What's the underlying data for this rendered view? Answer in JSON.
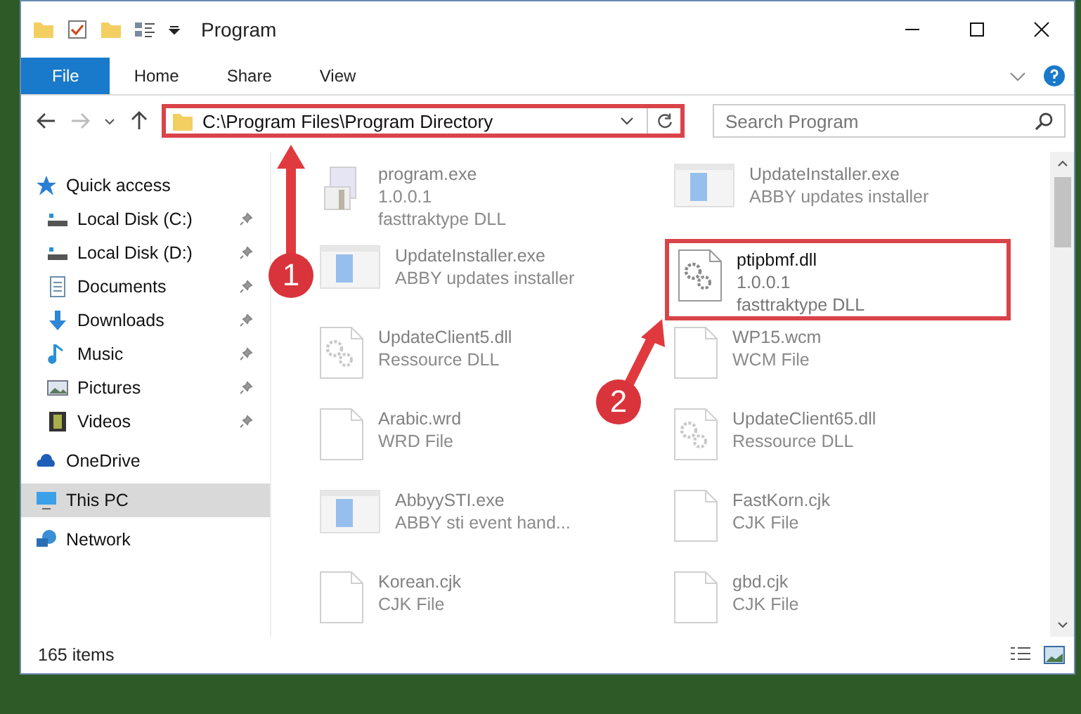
{
  "window": {
    "title": "Program"
  },
  "ribbon_tabs": [
    {
      "label": "File",
      "selected": true
    },
    {
      "label": "Home",
      "selected": false
    },
    {
      "label": "Share",
      "selected": false
    },
    {
      "label": "View",
      "selected": false
    }
  ],
  "address": {
    "path": "C:\\Program Files\\Program Directory",
    "highlighted": true
  },
  "search": {
    "placeholder": "Search Program"
  },
  "sidebar": {
    "items": [
      {
        "label": "Quick access",
        "kind": "star",
        "selected": false,
        "children": [
          {
            "label": "Local Disk (C:)",
            "kind": "drive",
            "pinned": true
          },
          {
            "label": "Local Disk (D:)",
            "kind": "drive",
            "pinned": true
          },
          {
            "label": "Documents",
            "kind": "documents",
            "pinned": true
          },
          {
            "label": "Downloads",
            "kind": "downloads",
            "pinned": true
          },
          {
            "label": "Music",
            "kind": "music",
            "pinned": true
          },
          {
            "label": "Pictures",
            "kind": "pictures",
            "pinned": true
          },
          {
            "label": "Videos",
            "kind": "videos",
            "pinned": true
          }
        ]
      },
      {
        "label": "OneDrive",
        "kind": "cloud",
        "selected": false
      },
      {
        "label": "This PC",
        "kind": "pc",
        "selected": true
      },
      {
        "label": "Network",
        "kind": "network",
        "selected": false
      }
    ]
  },
  "files": [
    {
      "name": "program.exe",
      "details": [
        "1.0.0.1",
        "fasttraktype DLL"
      ],
      "kind": "setup",
      "dimmed": true,
      "highlighted": false
    },
    {
      "name": "UpdateInstaller.exe",
      "details": [
        "ABBY updates installer"
      ],
      "kind": "app",
      "dimmed": true,
      "highlighted": false
    },
    {
      "name": "UpdateInstaller.exe",
      "details": [
        "ABBY updates installer"
      ],
      "kind": "app",
      "dimmed": true,
      "highlighted": false
    },
    {
      "name": "ptipbmf.dll",
      "details": [
        "1.0.0.1",
        "fasttraktype DLL"
      ],
      "kind": "dll",
      "dimmed": false,
      "highlighted": true
    },
    {
      "name": "UpdateClient5.dll",
      "details": [
        "Ressource DLL"
      ],
      "kind": "dll",
      "dimmed": true,
      "highlighted": false
    },
    {
      "name": "WP15.wcm",
      "details": [
        "WCM File"
      ],
      "kind": "file",
      "dimmed": true,
      "highlighted": false
    },
    {
      "name": "Arabic.wrd",
      "details": [
        "WRD File"
      ],
      "kind": "file",
      "dimmed": true,
      "highlighted": false
    },
    {
      "name": "UpdateClient65.dll",
      "details": [
        "Ressource DLL"
      ],
      "kind": "dll",
      "dimmed": true,
      "highlighted": false
    },
    {
      "name": "AbbyySTI.exe",
      "details": [
        "ABBY sti event hand..."
      ],
      "kind": "app",
      "dimmed": true,
      "highlighted": false
    },
    {
      "name": "FastKorn.cjk",
      "details": [
        "CJK File"
      ],
      "kind": "file",
      "dimmed": true,
      "highlighted": false
    },
    {
      "name": "Korean.cjk",
      "details": [
        "CJK File"
      ],
      "kind": "file",
      "dimmed": true,
      "highlighted": false
    },
    {
      "name": "gbd.cjk",
      "details": [
        "CJK File"
      ],
      "kind": "file",
      "dimmed": true,
      "highlighted": false
    }
  ],
  "status_bar": {
    "item_count": "165 items"
  },
  "callouts": [
    {
      "number": "1"
    },
    {
      "number": "2"
    }
  ]
}
